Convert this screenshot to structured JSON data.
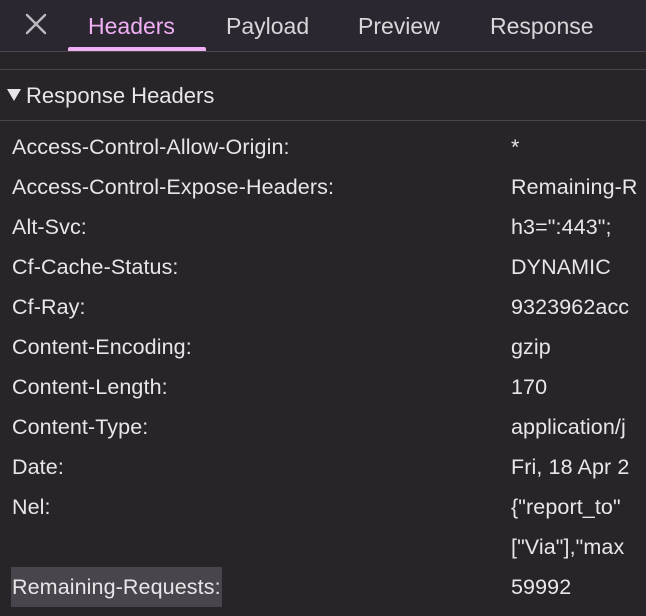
{
  "tabs": [
    {
      "label": "Headers",
      "active": true
    },
    {
      "label": "Payload",
      "active": false
    },
    {
      "label": "Preview",
      "active": false
    },
    {
      "label": "Response",
      "active": false
    }
  ],
  "section": {
    "title": "Response Headers"
  },
  "headers": [
    {
      "name": "Access-Control-Allow-Origin:",
      "value": "*"
    },
    {
      "name": "Access-Control-Expose-Headers:",
      "value": "Remaining-R"
    },
    {
      "name": "Alt-Svc:",
      "value": "h3=\":443\";"
    },
    {
      "name": "Cf-Cache-Status:",
      "value": "DYNAMIC"
    },
    {
      "name": "Cf-Ray:",
      "value": "9323962acc"
    },
    {
      "name": "Content-Encoding:",
      "value": "gzip"
    },
    {
      "name": "Content-Length:",
      "value": "170"
    },
    {
      "name": "Content-Type:",
      "value": "application/j"
    },
    {
      "name": "Date:",
      "value": "Fri, 18 Apr 2"
    },
    {
      "name": "Nel:",
      "value": "{\"report_to\""
    },
    {
      "name": "",
      "value": "[\"Via\"],\"max"
    },
    {
      "name": "Remaining-Requests:",
      "value": "59992"
    }
  ],
  "colors": {
    "background": "#282428",
    "accent": "#f0aef5",
    "text": "#e8e6e8",
    "selection": "#4a454d"
  },
  "icons": {
    "close": "close-icon",
    "disclosure": "triangle-down-icon"
  }
}
